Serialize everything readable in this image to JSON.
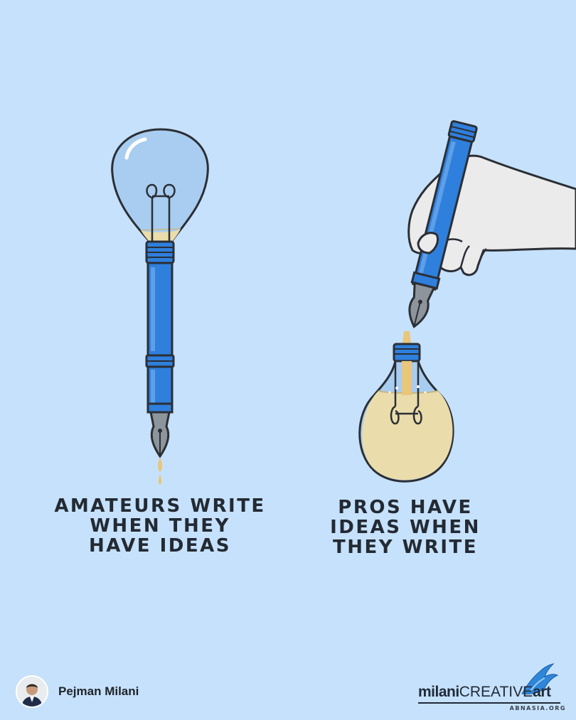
{
  "left_caption": {
    "line1": "AMATEURS WRITE",
    "line2": "WHEN THEY",
    "line3": "HAVE IDEAS"
  },
  "right_caption": {
    "line1": "PROS HAVE",
    "line2": "IDEAS WHEN",
    "line3": "THEY WRITE"
  },
  "author": {
    "name": "Pejman Milani",
    "avatar_icon": "author-avatar"
  },
  "brand": {
    "part1": "milani",
    "part2": "CREATIVE",
    "part3": "art",
    "subtext": "ABNASIA.ORG",
    "icon": "blue-bird-logo"
  },
  "colors": {
    "background": "#c6e1fb",
    "pen_blue": "#2f7fdc",
    "ink_gold": "#eadcab",
    "outline": "#2b2f35"
  }
}
